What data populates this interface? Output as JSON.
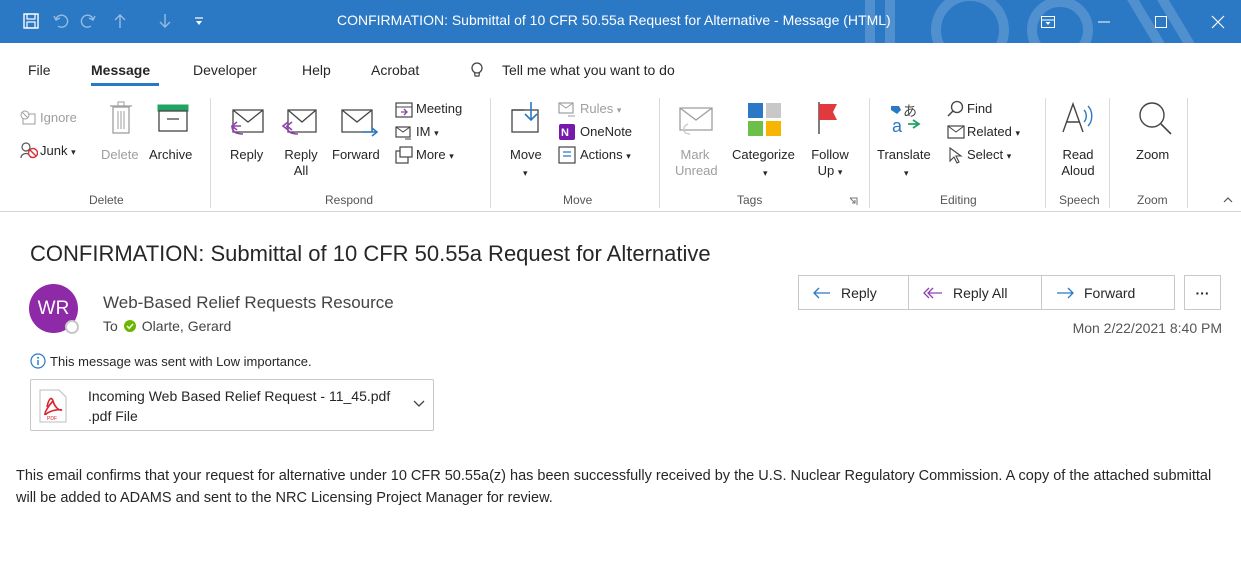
{
  "window": {
    "title": "CONFIRMATION: Submittal of 10 CFR 50.55a Request for Alternative  -  Message (HTML)"
  },
  "menu": [
    "File",
    "Message",
    "Developer",
    "Help",
    "Acrobat",
    "Tell me what you want to do"
  ],
  "ribbon": {
    "delete": {
      "ignore": "Ignore",
      "junk": "Junk",
      "junk_arrow": "▾",
      "delete": "Delete",
      "archive": "Archive",
      "group": "Delete"
    },
    "respond": {
      "reply": "Reply",
      "reply_all_1": "Reply",
      "reply_all_2": "All",
      "forward": "Forward",
      "meeting": "Meeting",
      "im": "IM",
      "more": "More",
      "group": "Respond"
    },
    "move": {
      "move": "Move",
      "move_arrow": "▾",
      "rules": "Rules",
      "onenote": "OneNote",
      "actions": "Actions",
      "group": "Move"
    },
    "tags": {
      "mark_1": "Mark",
      "mark_2": "Unread",
      "categorize": "Categorize",
      "categorize_arrow": "▾",
      "follow_1": "Follow",
      "follow_2": "Up",
      "group": "Tags"
    },
    "editing": {
      "translate": "Translate",
      "translate_arrow": "▾",
      "find": "Find",
      "related": "Related",
      "select": "Select",
      "group": "Editing"
    },
    "speech": {
      "read_1": "Read",
      "read_2": "Aloud",
      "group": "Speech"
    },
    "zoom": {
      "zoom": "Zoom",
      "group": "Zoom"
    }
  },
  "message": {
    "subject": "CONFIRMATION:  Submittal of 10 CFR 50.55a Request for Alternative",
    "avatar_initials": "WR",
    "sender": "Web-Based Relief Requests Resource",
    "to_label": "To",
    "recipient": "Olarte, Gerard",
    "importance": "This message was sent with Low importance.",
    "date": "Mon 2/22/2021 8:40 PM",
    "actions": {
      "reply": "Reply",
      "reply_all": "Reply All",
      "forward": "Forward",
      "more": "···"
    },
    "attachment": {
      "name": "Incoming Web Based Relief Request - 11_45.pdf",
      "type": ".pdf File",
      "badge": "PDF"
    },
    "body": "This email confirms that your request for alternative under 10 CFR 50.55a(z) has been successfully received by the U.S. Nuclear Regulatory Commission.  A copy of the attached submittal will be added to ADAMS and sent to the NRC Licensing Project Manager for review."
  },
  "colors": {
    "titlebar": "#2b78c4",
    "avatar": "#8e2aa8",
    "accent": "#2b78c4",
    "pdf": "#d9232e"
  }
}
